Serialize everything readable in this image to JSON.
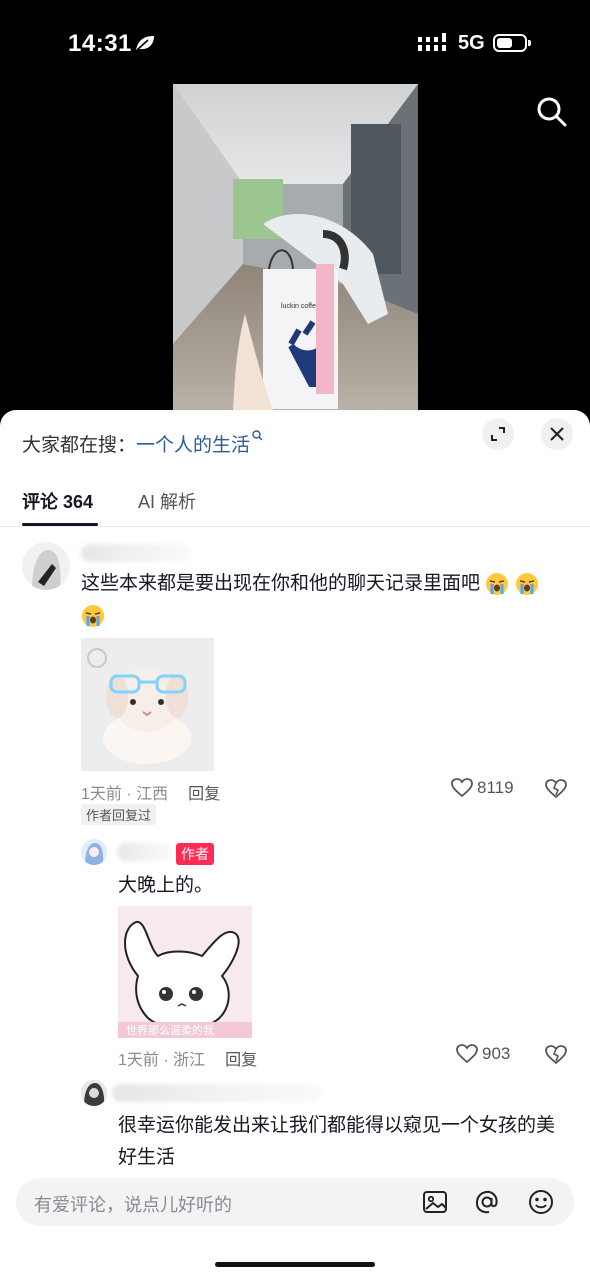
{
  "status_bar": {
    "time": "14:31",
    "network": "5G"
  },
  "search_bar": {
    "prefix": "大家都在搜：",
    "term": "一个人的生活"
  },
  "tabs": [
    {
      "label": "评论 364"
    },
    {
      "label": "AI 解析"
    }
  ],
  "comments": [
    {
      "text": "这些本来都是要出现在你和他的聊天记录里面吧",
      "meta": "1天前 · 江西",
      "reply_label": "回复",
      "likes": "8119",
      "tag": "作者回复过"
    },
    {
      "badge": "作者",
      "text": "大晚上的。",
      "meta": "1天前 · 浙江",
      "reply_label": "回复",
      "likes": "903"
    },
    {
      "text": "很幸运你能发出来让我们都能得以窥见一个女孩的美好生活"
    }
  ],
  "video": {
    "cup_text": "luckin coffee"
  },
  "sticker": {
    "caption": "世界那么温柔的我"
  },
  "input": {
    "placeholder": "有爱评论，说点儿好听的"
  },
  "colors": {
    "accent": "#fe2c55",
    "link": "#2d5b9a",
    "text": "#161823"
  }
}
